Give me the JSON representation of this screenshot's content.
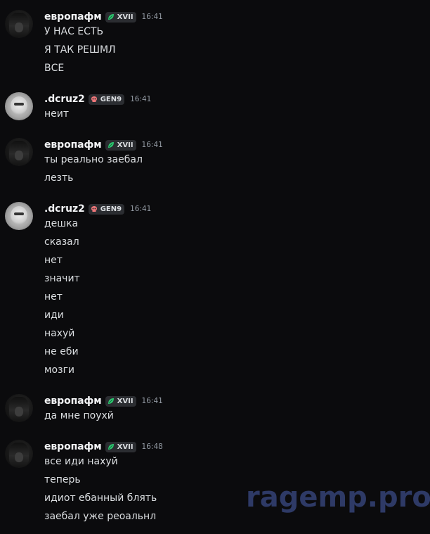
{
  "messages": [
    {
      "username": "европафм",
      "tag": "XVII",
      "tag_icon": "leaf-icon",
      "tag_color": "#2dc770",
      "time": "16:41",
      "avatar": "dark",
      "lines": [
        "У НАС ЕСТЬ",
        "Я ТАК РЕШМЛ",
        "ВСЕ"
      ]
    },
    {
      "username": ".dcruz2",
      "tag": "GEN9",
      "tag_icon": "skull-icon",
      "tag_color": "#f0777a",
      "time": "16:41",
      "avatar": "light",
      "lines": [
        "неит"
      ]
    },
    {
      "username": "европафм",
      "tag": "XVII",
      "tag_icon": "leaf-icon",
      "tag_color": "#2dc770",
      "time": "16:41",
      "avatar": "dark",
      "lines": [
        "ты реально заебал",
        "лезть"
      ]
    },
    {
      "username": ".dcruz2",
      "tag": "GEN9",
      "tag_icon": "skull-icon",
      "tag_color": "#f0777a",
      "time": "16:41",
      "avatar": "light",
      "lines": [
        "дешка",
        "сказал",
        "нет",
        "значит",
        "нет",
        "иди",
        "нахуй",
        "не еби",
        "мозги"
      ]
    },
    {
      "username": "европафм",
      "tag": "XVII",
      "tag_icon": "leaf-icon",
      "tag_color": "#2dc770",
      "time": "16:41",
      "avatar": "dark",
      "lines": [
        "да мне поухй"
      ]
    },
    {
      "username": "европафм",
      "tag": "XVII",
      "tag_icon": "leaf-icon",
      "tag_color": "#2dc770",
      "time": "16:48",
      "avatar": "dark",
      "lines": [
        "все иди нахуй",
        "теперь",
        "идиот ебанный блять",
        "заебал уже реоальнл"
      ]
    }
  ],
  "watermark": "ragemp.pro"
}
